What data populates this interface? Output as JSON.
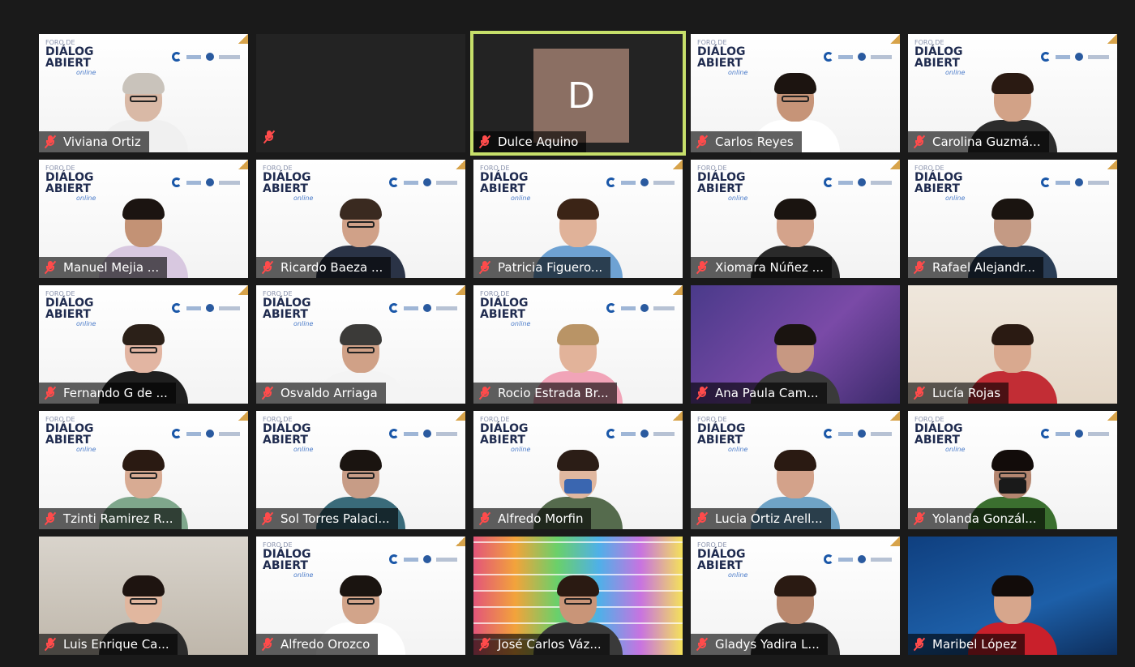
{
  "window": {
    "title": ""
  },
  "brand": {
    "line1": "FORO DE",
    "line2": "DIÁLOG",
    "line3": "ABIERT",
    "line4": "online"
  },
  "participants": [
    {
      "name": "Viviana Ortiz",
      "muted": true
    },
    {
      "name": "",
      "muted": true
    },
    {
      "name": "Dulce Aquino",
      "muted": true,
      "initial": "D",
      "active": true
    },
    {
      "name": "Carlos Reyes",
      "muted": true
    },
    {
      "name": "Carolina Guzmá...",
      "muted": true
    },
    {
      "name": "Manuel Mejia ...",
      "muted": true
    },
    {
      "name": "Ricardo Baeza ...",
      "muted": true
    },
    {
      "name": "Patricia Figuero...",
      "muted": true
    },
    {
      "name": "Xiomara Núñez ...",
      "muted": true
    },
    {
      "name": "Rafael Alejandr...",
      "muted": true
    },
    {
      "name": "Fernando G de ...",
      "muted": true
    },
    {
      "name": "Osvaldo Arriaga",
      "muted": true
    },
    {
      "name": "Rocio Estrada Br...",
      "muted": true
    },
    {
      "name": "Ana Paula Cam...",
      "muted": true
    },
    {
      "name": "Lucía Rojas",
      "muted": true
    },
    {
      "name": "Tzinti Ramirez R...",
      "muted": true
    },
    {
      "name": "Sol Torres Palaci...",
      "muted": true
    },
    {
      "name": "Alfredo Morfin",
      "muted": true
    },
    {
      "name": "Lucia Ortiz Arell...",
      "muted": true
    },
    {
      "name": "Yolanda Gonzál...",
      "muted": true
    },
    {
      "name": "Luis Enrique Ca...",
      "muted": true
    },
    {
      "name": "Alfredo Orozco",
      "muted": true
    },
    {
      "name": "José Carlos Váz...",
      "muted": true
    },
    {
      "name": "Gladys Yadira L...",
      "muted": true
    },
    {
      "name": "Maribel López",
      "muted": true
    }
  ],
  "colors": {
    "active_border": "#c6df6a",
    "mic_muted": "#ff4b4b"
  },
  "icons": {
    "mic": "mic-muted-icon"
  }
}
